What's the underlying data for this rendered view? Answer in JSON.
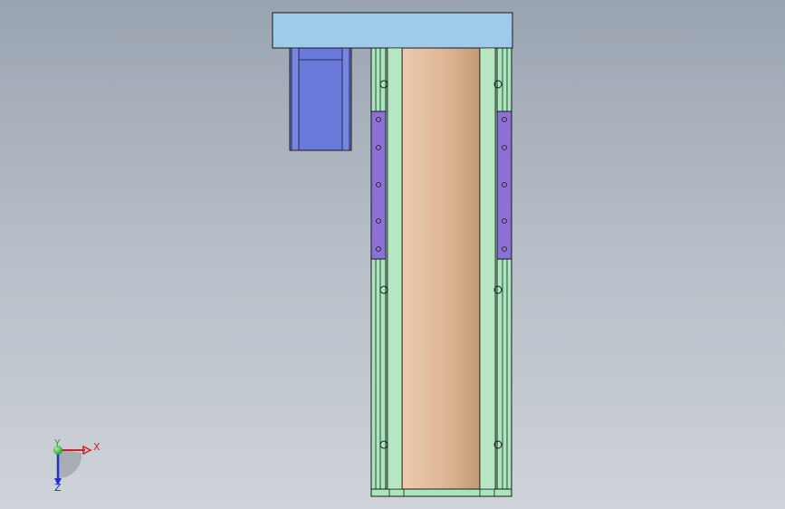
{
  "triad": {
    "x_label": "X",
    "y_label": "Y",
    "z_label": "Z",
    "x_color": "#d42020",
    "y_color": "#20b020",
    "z_color": "#2030d0"
  },
  "parts": {
    "top_plate_color": "#9dcbe9",
    "motor_color": "#6a79dc",
    "rail_frame_color": "#a9e6bd",
    "slider_color": "#8c70d6",
    "carriage_color": "#dcb58f"
  }
}
